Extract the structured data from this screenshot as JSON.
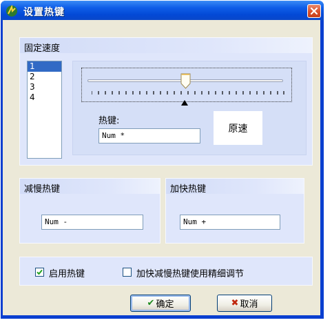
{
  "window": {
    "title": "设置热键"
  },
  "fixed_speed": {
    "group_title": "固定速度",
    "list_items": [
      "1",
      "2",
      "3",
      "4"
    ],
    "selected_item": "1",
    "slider": {
      "value_fraction": 0.5
    },
    "hotkey_label": "热键:",
    "hotkey_value": "Num *",
    "reset_button": "原速"
  },
  "slow_down": {
    "group_title": "减慢热键",
    "hotkey_value": "Num -"
  },
  "speed_up": {
    "group_title": "加快热键",
    "hotkey_value": "Num +"
  },
  "options": {
    "enable_hotkeys": {
      "label": "启用热键",
      "checked": true
    },
    "fine_adjust": {
      "label": "加快减慢热键使用精细调节",
      "checked": false
    }
  },
  "buttons": {
    "ok": "确定",
    "cancel": "取消"
  },
  "colors": {
    "title_blue": "#0a3fd0",
    "selection": "#316ac5",
    "group_bg": "#dfe6fb",
    "ok_check": "#1e8a1e",
    "cancel_x": "#c0280f"
  }
}
